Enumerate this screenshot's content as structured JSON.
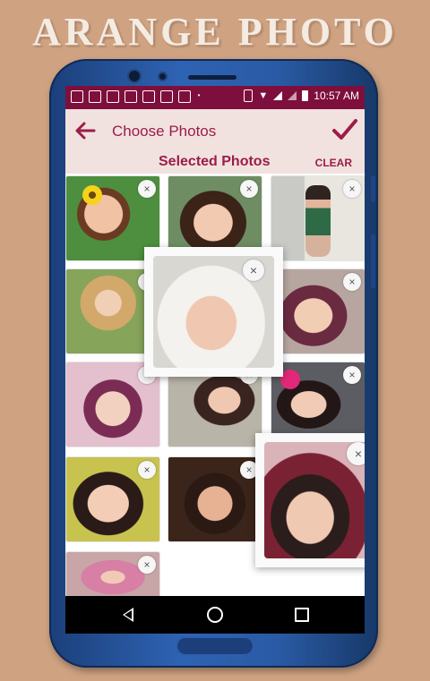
{
  "banner": {
    "text": "ARANGE PHOTO"
  },
  "status_bar": {
    "time": "10:57 AM"
  },
  "app_bar": {
    "title": "Choose Photos"
  },
  "selection": {
    "title": "Selected Photos",
    "clear_label": "CLEAR"
  },
  "close_glyph": "×",
  "colors": {
    "accent": "#9c1c4a",
    "status_bar": "#7e0f3c",
    "app_bar_bg": "#f1e2df",
    "page_bg": "#cfa382",
    "phone_frame": "#2a5aa4"
  },
  "icons": [
    "back-arrow-icon",
    "checkmark-icon",
    "close-icon",
    "nav-back-icon",
    "nav-home-icon",
    "nav-recent-icon"
  ],
  "photos": [
    {
      "name": "baby-yellow-flower"
    },
    {
      "name": "girl-hair-bow"
    },
    {
      "name": "girl-standing-door"
    },
    {
      "name": "girl-in-grass"
    },
    {
      "name": "toddler-purple-hat"
    },
    {
      "name": "baby-purple-knit-hat"
    },
    {
      "name": "smiling-girl"
    },
    {
      "name": "baby-pink-flower"
    },
    {
      "name": "girl-dark-hair"
    },
    {
      "name": "smiling-girl-closeup"
    },
    {
      "name": "girl-pink-dress"
    }
  ],
  "dragged_photos": [
    {
      "name": "sleeping-newborn-white-blanket"
    },
    {
      "name": "sleeping-child-maroon-hat"
    }
  ]
}
